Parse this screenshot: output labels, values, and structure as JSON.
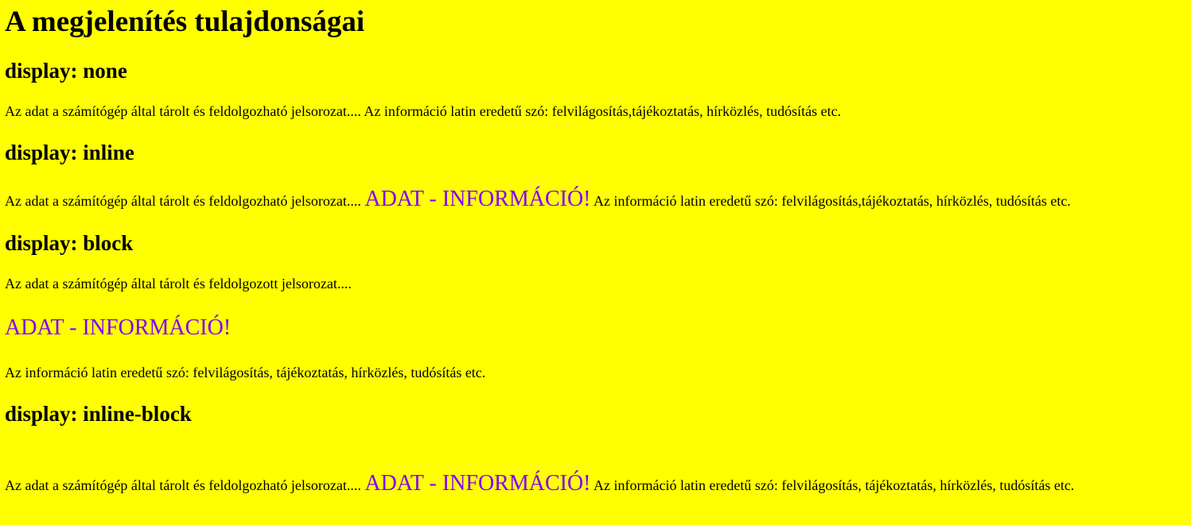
{
  "page": {
    "title": "A megjelenítés tulajdonságai",
    "background_color": "#ffff00",
    "highlight_color": "#8000ff"
  },
  "sections": {
    "none": {
      "heading": "display: none",
      "text": "Az adat a számítógép által tárolt és feldolgozható jelsorozat.... Az információ latin eredetű szó: felvilágosítás,tájékoztatás, hírközlés, tudósítás etc."
    },
    "inline": {
      "heading": "display: inline",
      "text_before": "Az adat a számítógép által tárolt és feldolgozható jelsorozat.... ",
      "highlight": "ADAT - INFORMÁCIÓ!",
      "text_after": " Az információ latin eredetű szó: felvilágosítás,tájékoztatás, hírközlés, tudósítás etc."
    },
    "block": {
      "heading": "display: block",
      "text_before": "Az adat a számítógép által tárolt és feldolgozott jelsorozat....",
      "highlight": "ADAT - INFORMÁCIÓ!",
      "text_after": "Az információ latin eredetű szó: felvilágosítás, tájékoztatás, hírközlés, tudósítás etc."
    },
    "inline_block": {
      "heading": "display: inline-block",
      "text_before": "Az adat a számítógép által tárolt és feldolgozható jelsorozat.... ",
      "highlight": "ADAT - INFORMÁCIÓ!",
      "text_after": " Az információ latin eredetű szó: felvilágosítás, tájékoztatás, hírközlés, tudósítás etc."
    }
  }
}
